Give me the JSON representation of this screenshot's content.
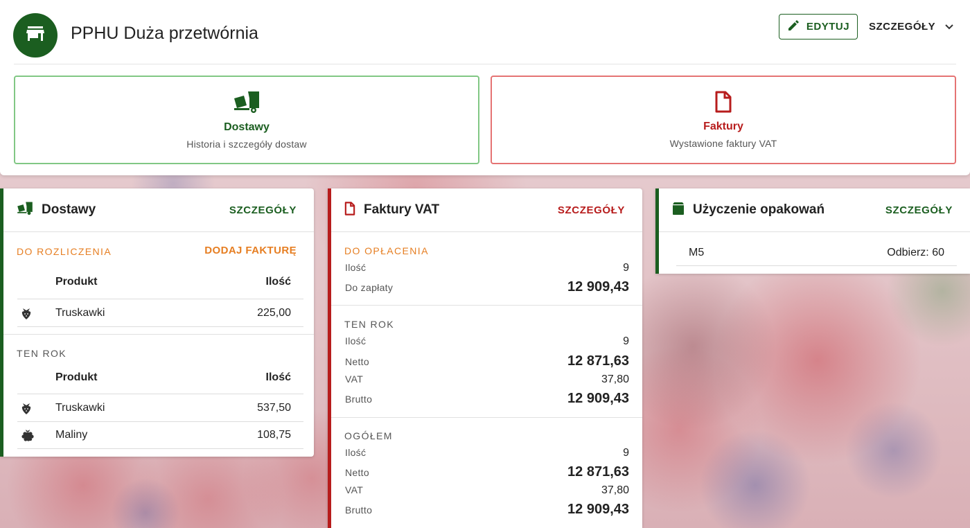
{
  "header": {
    "title": "PPHU Duża przetwórnia",
    "avatar_icon": "store-icon",
    "edit_label": "EDYTUJ",
    "details_label": "SZCZEGÓŁY"
  },
  "nav_cards": {
    "deliveries": {
      "title": "Dostawy",
      "subtitle": "Historia i szczegóły dostaw",
      "icon": "truck-icon"
    },
    "invoices": {
      "title": "Faktury",
      "subtitle": "Wystawione faktury VAT",
      "icon": "document-icon"
    }
  },
  "colors": {
    "green": "#1b5e20",
    "red": "#b71c1c",
    "orange": "#e67e22"
  },
  "deliveries_panel": {
    "title": "Dostawy",
    "details_label": "SZCZEGÓŁY",
    "to_settle": {
      "label": "DO ROZLICZENIA",
      "add_invoice_label": "DODAJ FAKTURĘ",
      "col_product": "Produkt",
      "col_qty": "Ilość",
      "rows": [
        {
          "icon": "strawberry-icon",
          "name": "Truskawki",
          "qty": "225,00"
        }
      ]
    },
    "this_year": {
      "label": "TEN ROK",
      "col_product": "Produkt",
      "col_qty": "Ilość",
      "rows": [
        {
          "icon": "strawberry-icon",
          "name": "Truskawki",
          "qty": "537,50"
        },
        {
          "icon": "raspberry-icon",
          "name": "Maliny",
          "qty": "108,75"
        }
      ]
    }
  },
  "invoices_panel": {
    "title": "Faktury VAT",
    "details_label": "SZCZEGÓŁY",
    "to_pay": {
      "label": "DO OPŁACENIA",
      "count_label": "Ilość",
      "count": "9",
      "due_label": "Do zapłaty",
      "due": "12 909,43"
    },
    "this_year": {
      "label": "TEN ROK",
      "count_label": "Ilość",
      "count": "9",
      "net_label": "Netto",
      "net": "12 871,63",
      "vat_label": "VAT",
      "vat": "37,80",
      "gross_label": "Brutto",
      "gross": "12 909,43"
    },
    "total": {
      "label": "OGÓŁEM",
      "count_label": "Ilość",
      "count": "9",
      "net_label": "Netto",
      "net": "12 871,63",
      "vat_label": "VAT",
      "vat": "37,80",
      "gross_label": "Brutto",
      "gross": "12 909,43"
    }
  },
  "packaging_panel": {
    "title": "Użyczenie opakowań",
    "details_label": "SZCZEGÓŁY",
    "rows": [
      {
        "name": "M5",
        "value": "Odbierz: 60"
      }
    ]
  }
}
